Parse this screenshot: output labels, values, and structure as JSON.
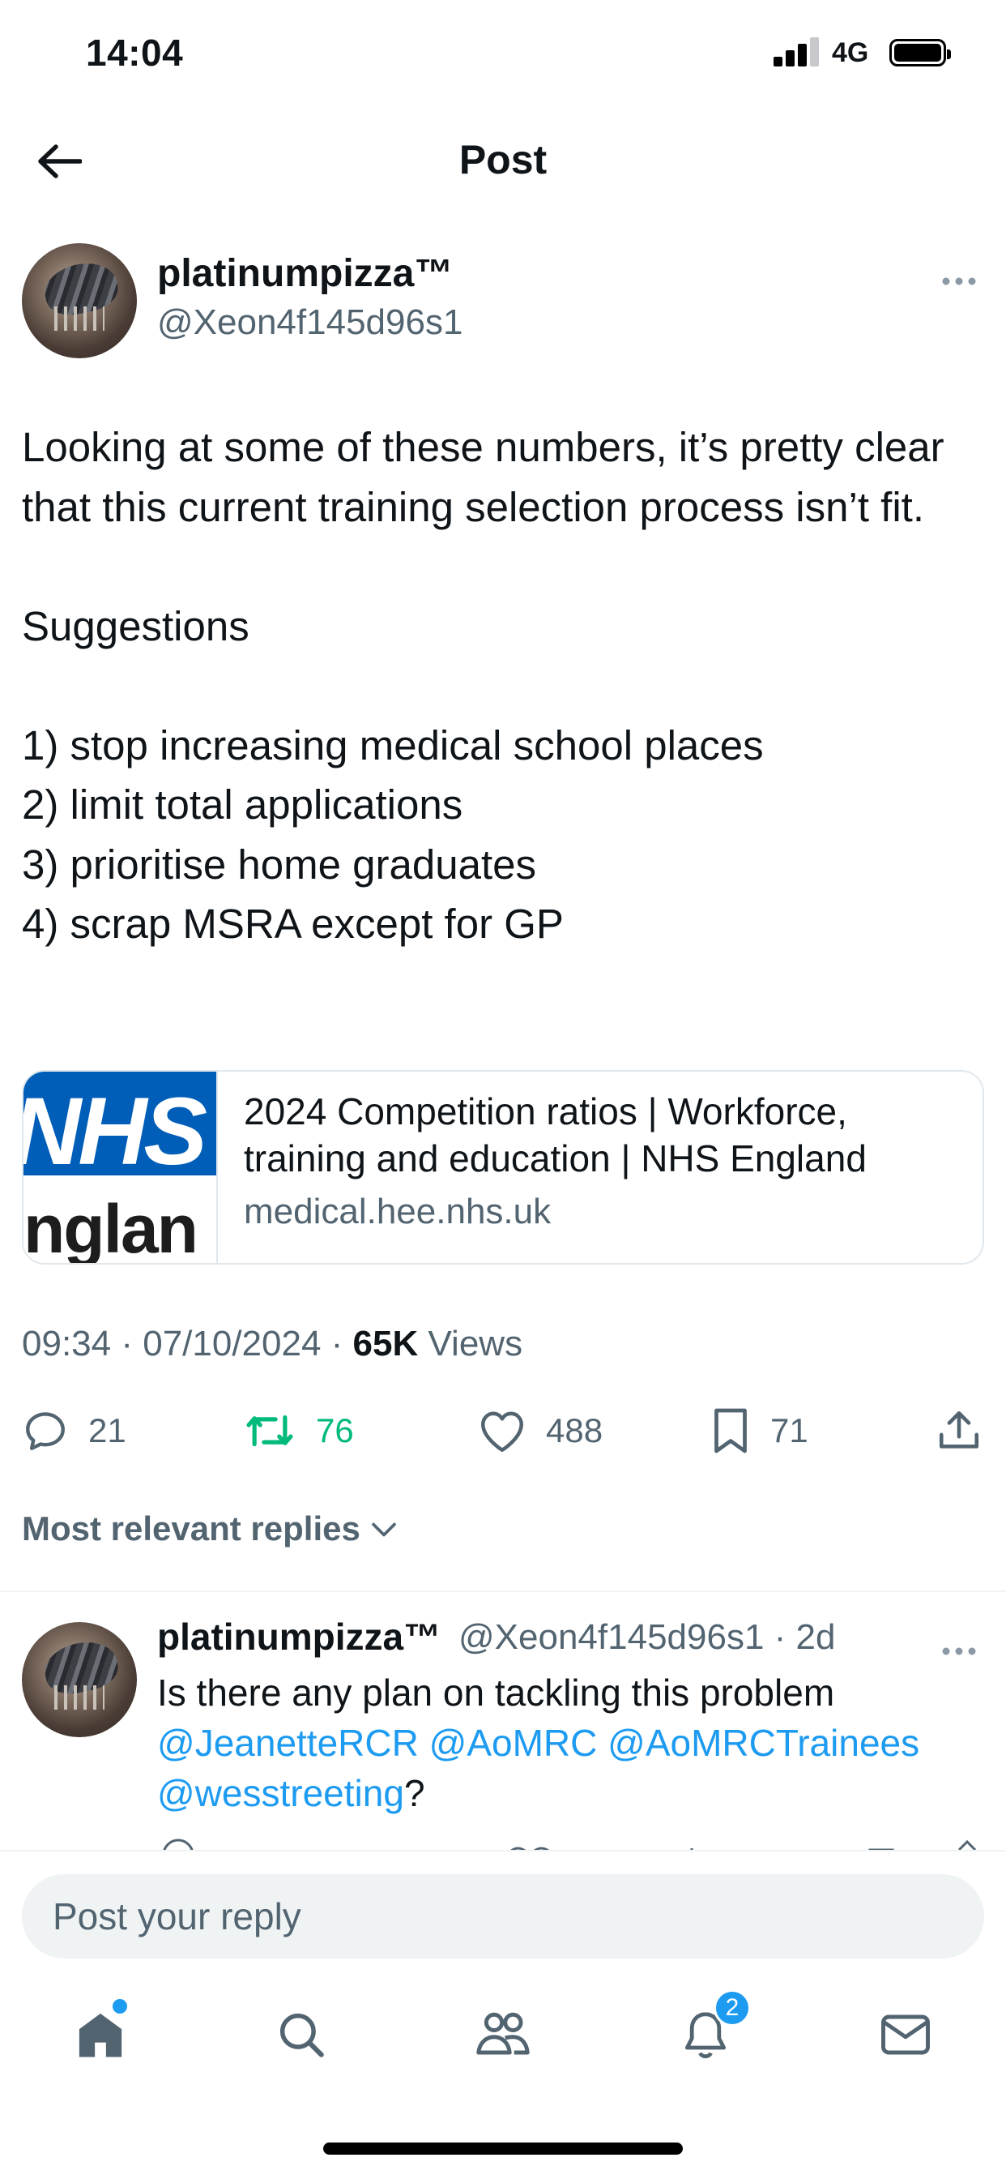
{
  "status_bar": {
    "time": "14:04",
    "network": "4G"
  },
  "header": {
    "title": "Post"
  },
  "post": {
    "author_name": "platinumpizza™",
    "author_handle": "@Xeon4f145d96s1",
    "text": "Looking at some of these numbers, it’s pretty clear that this current training selection process isn’t fit.\n\nSuggestions\n\n1) stop increasing medical school places\n2) limit total applications\n3) prioritise home graduates\n4) scrap MSRA except for GP",
    "link_card": {
      "thumb_top": "NHS",
      "thumb_bottom": "nglan",
      "title": "2024 Competition ratios | Workforce, training and education | NHS England",
      "domain": "medical.hee.nhs.uk"
    },
    "time": "09:34",
    "date": "07/10/2024",
    "views_count": "65K",
    "views_label": "Views",
    "stats": {
      "replies": "21",
      "reposts": "76",
      "likes": "488",
      "bookmarks": "71"
    }
  },
  "replies_section": {
    "sort_label": "Most relevant replies"
  },
  "reply": {
    "author_name": "platinumpizza™",
    "handle": "@Xeon4f145d96s1",
    "age": "2d",
    "text_prefix": "Is there any plan on tackling this problem ",
    "mentions": [
      "@JeanetteRCR",
      "@AoMRC",
      "@AoMRCTrainees",
      "@wesstreeting"
    ],
    "text_suffix": "?"
  },
  "composer": {
    "placeholder": "Post your reply"
  },
  "tab_bar": {
    "notifications_badge": "2"
  },
  "colors": {
    "accent": "#1d9bf0",
    "repost_active": "#00ba7c",
    "secondary_text": "#536471"
  }
}
